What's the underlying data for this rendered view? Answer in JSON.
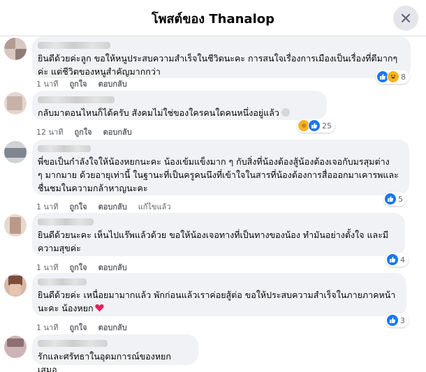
{
  "header": {
    "title": "โพสต์ของ Thanalop"
  },
  "comments": [
    {
      "text": "ยินดีด้วยค่ะลูก ขอให้หนูประสบความสำเร็จในชีวิตนะคะ การสนใจเรื่องการเมืองเป็นเรื่องที่ดีมากๆ\nค่ะ แต่ชีวิตของหนูสำคัญมากกว่า",
      "time": "1 นาที",
      "like": "ถูกใจ",
      "reply": "ตอบกลับ",
      "reactions": "8"
    },
    {
      "text": "กลับมาตอนไหนก็ได้ครับ สังคมไม่ใช่ของใครคนใดคนหนึ่งอยู่แล้ว",
      "time": "12 นาที",
      "like": "ถูกใจ",
      "reply": "ตอบกลับ",
      "reactions": "25"
    },
    {
      "text": "พี่ขอเป็นกำลังใจให้น้องหยกนะคะ น้องเข้มแข็งมาก ๆ กับสิ่งที่น้องต้องสู้น้องต้องเจอกับมรสุมต่าง\nๆ มากมาย ด้วยอายุเท่านี้ ในฐานะที่เป็นครูคนนึงที่เข้าใจในสารที่น้องต้องการสื่อออกมาเคารพและ\nชื่นชมในความกล้าหาญนะคะ",
      "time": "1 นาที",
      "like": "ถูกใจ",
      "reply": "ตอบกลับ",
      "edited": "แก้ไขแล้ว",
      "reactions": "5"
    },
    {
      "text": "ยินดีด้วยนะคะ เห็นไปแร๊พแล้วด้วย ขอให้น้องเจอทางที่เป็นทางของน้อง ทำมันอย่างตั้งใจ และมี\nความสุขค่ะ",
      "time": "1 นาที",
      "like": "ถูกใจ",
      "reply": "ตอบกลับ",
      "reactions": "4"
    },
    {
      "text": "ยินดีด้วยค่ะ เหนื่อยมามากแล้ว พักก่อนแล้วเราค่อยสู้ต่อ ขอให้ประสบความสำเร็จในภายภาคหน้า\nนะคะ น้องหยก",
      "time": "1 นาที",
      "like": "ถูกใจ",
      "reply": "ตอบกลับ",
      "reactions": "3"
    },
    {
      "text": "รักและศรัทธาในอุดมการณ์ของหยกเสมอ"
    }
  ],
  "icons": {
    "close": "close-icon",
    "like": "like-icon",
    "haha": "haha-icon",
    "love": "love-icon",
    "care": "care-icon",
    "heart": "red-heart-icon"
  },
  "colors": {
    "like": "#1877f2",
    "haha": "#f7b125",
    "love": "#f33e58",
    "bubble": "#f0f2f5",
    "meta": "#65676b"
  }
}
